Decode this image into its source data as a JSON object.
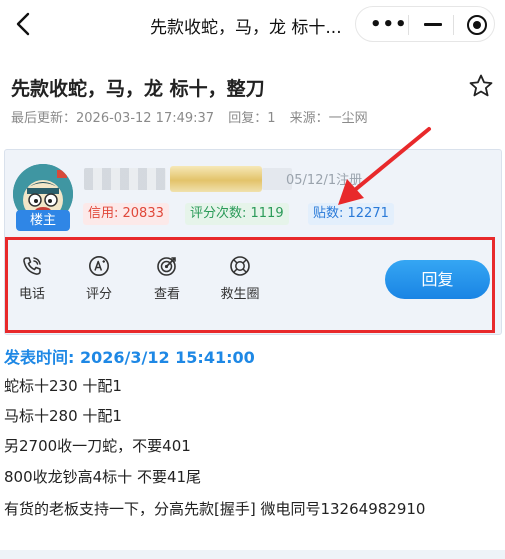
{
  "nav": {
    "back_icon": "chevron-left-icon",
    "title": "先款收蛇，马，龙 标十..."
  },
  "capsule": {
    "more_icon": "more-dots-icon",
    "minimize_icon": "minimize-icon",
    "close_icon": "target-close-icon"
  },
  "post": {
    "title": "先款收蛇，马，龙 标十，整刀",
    "favorite_icon": "star-outline-icon",
    "meta": {
      "updated": "最后更新：2026-03-12 17:49:37",
      "replies": "回复：1",
      "source": "来源：一尘网"
    }
  },
  "author": {
    "badge": "楼主",
    "register_text": "05/12/1注册",
    "stats": {
      "credit": "信用: 20833",
      "rating_count": "评分次数: 1119",
      "post_count": "贴数: 12271"
    }
  },
  "actions": [
    {
      "label": "电话",
      "icon": "phone-icon"
    },
    {
      "label": "评分",
      "icon": "rate-icon"
    },
    {
      "label": "查看",
      "icon": "target-view-icon"
    },
    {
      "label": "救生圈",
      "icon": "lifebuoy-icon"
    }
  ],
  "reply_button": "回复",
  "content": {
    "posted_time": "发表时间:  2026/3/12 15:41:00",
    "lines": [
      "蛇标十230 十配1",
      "马标十280  十配1",
      "另2700收一刀蛇，不要401",
      "800收龙钞高4标十  不要41尾",
      "有货的老板支持一下，分高先款[握手]   微电同号13264982910"
    ]
  },
  "colors": {
    "accent_blue": "#1e88e5",
    "highlight_red": "#e8292b",
    "credit_red": "#e0483a",
    "rating_green": "#2a9a58"
  }
}
